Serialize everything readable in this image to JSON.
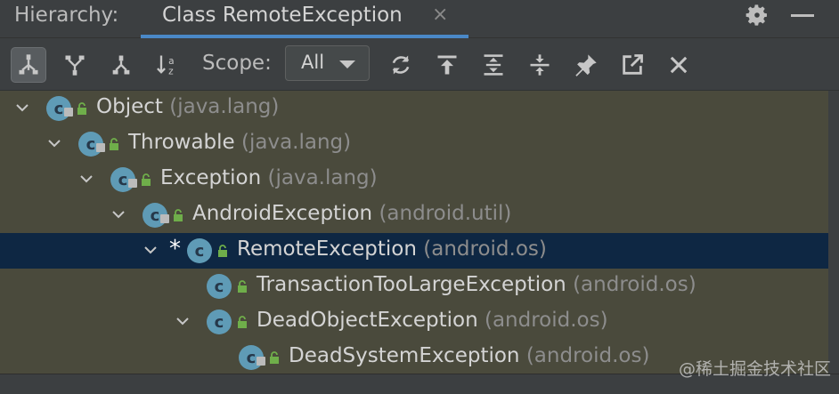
{
  "tabbar": {
    "title": "Hierarchy:",
    "tab_label": "Class RemoteException",
    "close_glyph": "×"
  },
  "toolbar": {
    "buttons": [
      {
        "name": "subtypes-hierarchy-icon",
        "active": true
      },
      {
        "name": "supertypes-hierarchy-icon",
        "active": false
      },
      {
        "name": "class-hierarchy-icon",
        "active": false
      },
      {
        "name": "sort-alphabetically-icon",
        "active": false
      }
    ],
    "scope_label": "Scope:",
    "scope_value": "All",
    "actions": [
      "refresh-icon",
      "scroll-to-source-icon",
      "expand-all-icon",
      "collapse-all-icon",
      "pin-icon",
      "open-external-icon",
      "close-icon"
    ]
  },
  "tree": {
    "rows": [
      {
        "name": "Object",
        "package": "(java.lang)",
        "depth": 0,
        "expanded": true,
        "selected": false,
        "current": false,
        "kind": "class-lib"
      },
      {
        "name": "Throwable",
        "package": "(java.lang)",
        "depth": 1,
        "expanded": true,
        "selected": false,
        "current": false,
        "kind": "class-lib"
      },
      {
        "name": "Exception",
        "package": "(java.lang)",
        "depth": 2,
        "expanded": true,
        "selected": false,
        "current": false,
        "kind": "class-lib"
      },
      {
        "name": "AndroidException",
        "package": "(android.util)",
        "depth": 3,
        "expanded": true,
        "selected": false,
        "current": false,
        "kind": "class-lib"
      },
      {
        "name": "RemoteException",
        "package": "(android.os)",
        "depth": 4,
        "expanded": true,
        "selected": true,
        "current": true,
        "marker": "*",
        "kind": "class"
      },
      {
        "name": "TransactionTooLargeException",
        "package": "(android.os)",
        "depth": 5,
        "expanded": false,
        "leaf": true,
        "selected": false,
        "current": false,
        "kind": "class"
      },
      {
        "name": "DeadObjectException",
        "package": "(android.os)",
        "depth": 5,
        "expanded": true,
        "selected": false,
        "current": false,
        "kind": "class"
      },
      {
        "name": "DeadSystemException",
        "package": "(android.os)",
        "depth": 6,
        "expanded": false,
        "leaf": true,
        "selected": false,
        "current": false,
        "kind": "class-lib"
      }
    ]
  },
  "watermark": "@稀土掘金技术社区",
  "colors": {
    "tree_background": "#4a4a3c",
    "selected_row": "#0e2743",
    "class_icon": "#5f9bb6",
    "visibility_icon": "#6fae4a",
    "accent_underline": "#4a88c7"
  }
}
